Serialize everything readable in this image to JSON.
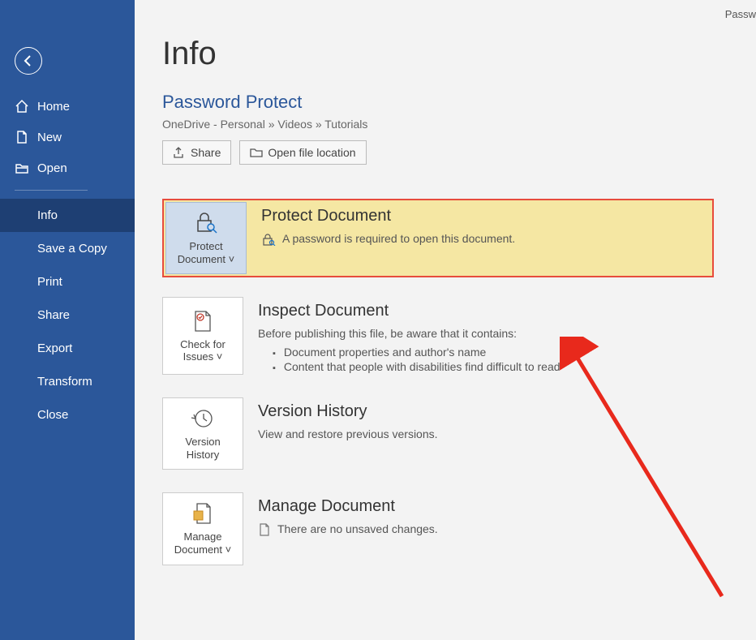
{
  "top_right_text": "Passw",
  "sidebar": {
    "items": [
      {
        "label": "Home"
      },
      {
        "label": "New"
      },
      {
        "label": "Open"
      }
    ],
    "subitems": [
      {
        "label": "Info",
        "active": true
      },
      {
        "label": "Save a Copy"
      },
      {
        "label": "Print"
      },
      {
        "label": "Share"
      },
      {
        "label": "Export"
      },
      {
        "label": "Transform"
      },
      {
        "label": "Close"
      }
    ]
  },
  "main": {
    "page_title": "Info",
    "doc_title": "Password Protect",
    "breadcrumb": "OneDrive - Personal » Videos » Tutorials",
    "share_label": "Share",
    "open_location_label": "Open file location"
  },
  "protect": {
    "tile_label": "Protect Document",
    "title": "Protect Document",
    "desc": "A password is required to open this document."
  },
  "inspect": {
    "tile_label": "Check for Issues",
    "title": "Inspect Document",
    "desc": "Before publishing this file, be aware that it contains:",
    "bullets": [
      "Document properties and author's name",
      "Content that people with disabilities find difficult to read"
    ]
  },
  "version": {
    "tile_label": "Version History",
    "title": "Version History",
    "desc": "View and restore previous versions."
  },
  "manage": {
    "tile_label": "Manage Document",
    "title": "Manage Document",
    "desc": "There are no unsaved changes."
  }
}
